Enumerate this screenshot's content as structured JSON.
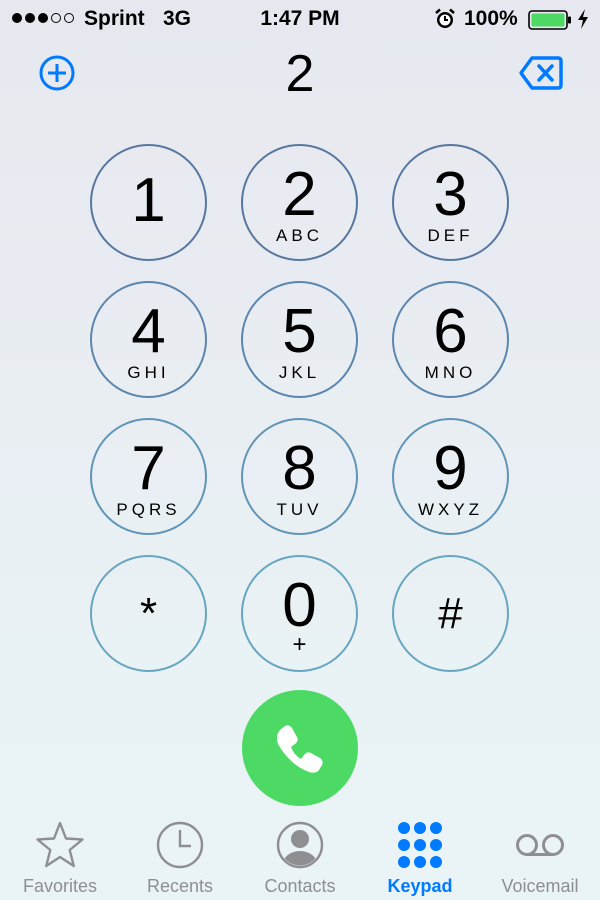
{
  "status_bar": {
    "carrier": "Sprint",
    "network": "3G",
    "time": "1:47 PM",
    "battery": "100%",
    "signal_bars_filled": 3,
    "signal_bars_total": 5
  },
  "dialer": {
    "number": "2"
  },
  "keypad": [
    {
      "digit": "1",
      "letters": ""
    },
    {
      "digit": "2",
      "letters": "ABC"
    },
    {
      "digit": "3",
      "letters": "DEF"
    },
    {
      "digit": "4",
      "letters": "GHI"
    },
    {
      "digit": "5",
      "letters": "JKL"
    },
    {
      "digit": "6",
      "letters": "MNO"
    },
    {
      "digit": "7",
      "letters": "PQRS"
    },
    {
      "digit": "8",
      "letters": "TUV"
    },
    {
      "digit": "9",
      "letters": "WXYZ"
    },
    {
      "digit": "*",
      "letters": ""
    },
    {
      "digit": "0",
      "letters": "+"
    },
    {
      "digit": "#",
      "letters": ""
    }
  ],
  "tabs": [
    {
      "label": "Favorites",
      "icon": "star-icon",
      "active": false
    },
    {
      "label": "Recents",
      "icon": "clock-icon",
      "active": false
    },
    {
      "label": "Contacts",
      "icon": "contact-person-icon",
      "active": false
    },
    {
      "label": "Keypad",
      "icon": "keypad-grid-icon",
      "active": true
    },
    {
      "label": "Voicemail",
      "icon": "voicemail-icon",
      "active": false
    }
  ],
  "colors": {
    "accent": "#007aff",
    "call_green": "#4cd964",
    "inactive_gray": "#8e8e93",
    "key_border_top": "#5a7aa3",
    "key_border_bottom": "#6aaec4"
  }
}
